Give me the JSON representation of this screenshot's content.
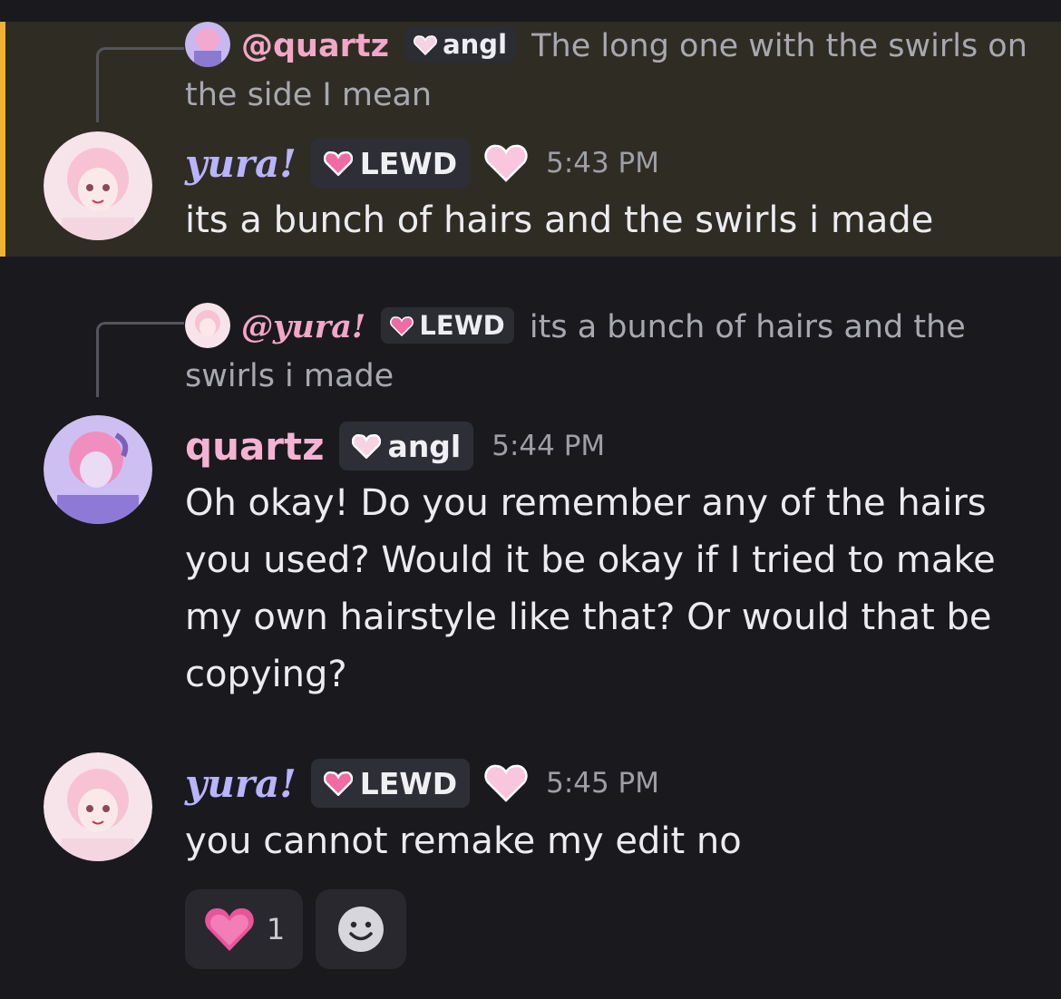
{
  "messages": [
    {
      "reply": {
        "mention": "@quartz",
        "tag": "angl",
        "text": "The long one with the swirls on the side I mean"
      },
      "author": "yura!",
      "tag": "LEWD",
      "time": "5:43 PM",
      "body": "its a bunch of hairs and the swirls i made"
    },
    {
      "reply": {
        "mention": "@yura!",
        "tag": "LEWD",
        "text": "its a bunch of hairs and the swirls i made"
      },
      "author": "quartz",
      "tag": "angl",
      "time": "5:44 PM",
      "body": "Oh okay! Do you remember any of the hairs you used? Would it be okay if I tried to make my own hairstyle like that? Or would that be copying?"
    },
    {
      "author": "yura!",
      "tag": "LEWD",
      "time": "5:45 PM",
      "body": "you cannot remake my edit no"
    }
  ],
  "reactions": [
    {
      "emoji": "heart",
      "count": "1"
    },
    {
      "emoji": "add-reaction"
    }
  ],
  "colors": {
    "background": "#1a1a1e",
    "highlight": "#2f2c24",
    "highlight_bar": "#f0b232",
    "yura_name": "#b9b4ff",
    "quartz_name": "#f5b3d3"
  }
}
